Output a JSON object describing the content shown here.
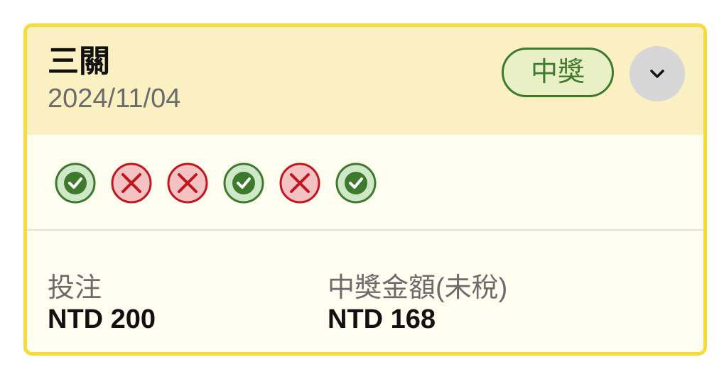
{
  "card": {
    "title": "三關",
    "date": "2024/11/04",
    "status_badge": "中獎",
    "expand_icon": "chevron-down-icon",
    "results": [
      "correct",
      "wrong",
      "wrong",
      "correct",
      "wrong",
      "correct"
    ],
    "bet_label": "投注",
    "bet_value": "NTD 200",
    "payout_label": "中獎金額(未稅)",
    "payout_value": "NTD 168"
  },
  "colors": {
    "border": "#f7db3c",
    "header_bg": "#fbf0c2",
    "body_bg": "#fffcf0",
    "win_green": "#3d7a2d",
    "win_fill": "#cfe8c8",
    "lose_red": "#c0161f",
    "lose_fill": "#f4c2c2"
  }
}
